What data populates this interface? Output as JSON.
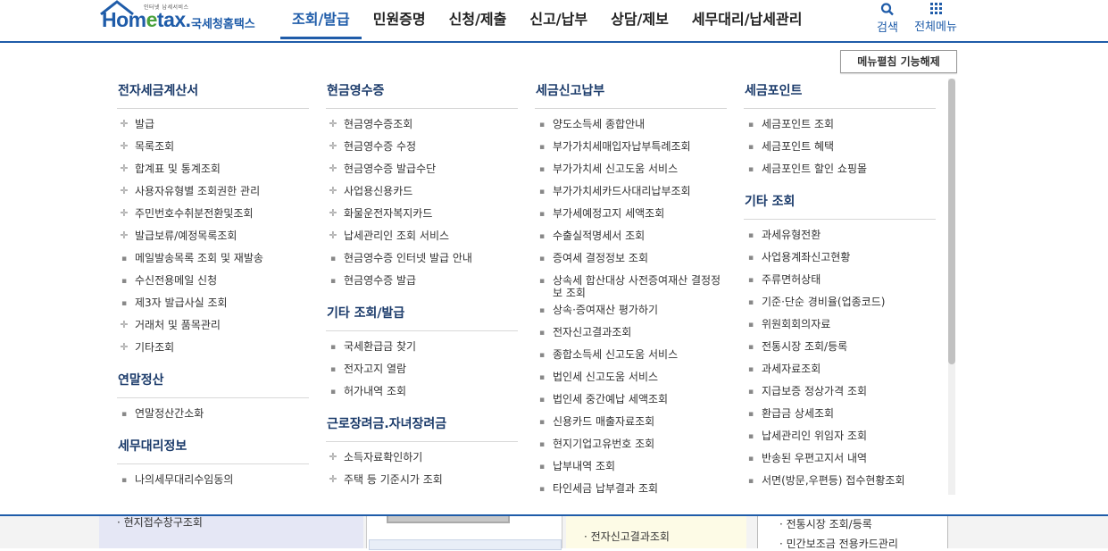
{
  "header": {
    "logo_small": "인터넷 납세서비스",
    "logo_brand_pre": "Hom",
    "logo_brand_e": "e",
    "logo_brand_post": "tax.",
    "logo_korean": "국세청홈택스",
    "nav": [
      {
        "label": "조회/발급",
        "active": true
      },
      {
        "label": "민원증명"
      },
      {
        "label": "신청/제출"
      },
      {
        "label": "신고/납부"
      },
      {
        "label": "상담/제보"
      },
      {
        "label": "세무대리/납세관리"
      }
    ],
    "search_label": "검색",
    "allmenu_label": "전체메뉴"
  },
  "panel": {
    "lock_button": "메뉴펼침 기능해제",
    "columns": [
      {
        "sections": [
          {
            "title": "전자세금계산서",
            "items": [
              {
                "label": "발급",
                "marker": "plus"
              },
              {
                "label": "목록조회",
                "marker": "plus"
              },
              {
                "label": "합계표 및 통계조회",
                "marker": "plus"
              },
              {
                "label": "사용자유형별 조회권한 관리",
                "marker": "plus"
              },
              {
                "label": "주민번호수취분전환및조회",
                "marker": "plus"
              },
              {
                "label": "발급보류/예정목록조회",
                "marker": "plus"
              },
              {
                "label": "메일발송목록 조회 및 재발송",
                "marker": "dot"
              },
              {
                "label": "수신전용메일 신청",
                "marker": "dot"
              },
              {
                "label": "제3자 발급사실 조회",
                "marker": "dot"
              },
              {
                "label": "거래처 및 품목관리",
                "marker": "plus"
              },
              {
                "label": "기타조회",
                "marker": "plus"
              }
            ]
          },
          {
            "title": "연말정산",
            "items": [
              {
                "label": "연말정산간소화",
                "marker": "dot"
              }
            ]
          },
          {
            "title": "세무대리정보",
            "items": [
              {
                "label": "나의세무대리수임동의",
                "marker": "dot"
              }
            ]
          }
        ]
      },
      {
        "sections": [
          {
            "title": "현금영수증",
            "items": [
              {
                "label": "현금영수증조회",
                "marker": "plus"
              },
              {
                "label": "현금영수증 수정",
                "marker": "plus"
              },
              {
                "label": "현금영수증 발급수단",
                "marker": "plus"
              },
              {
                "label": "사업용신용카드",
                "marker": "plus"
              },
              {
                "label": "화물운전자복지카드",
                "marker": "plus"
              },
              {
                "label": "납세관리인 조회 서비스",
                "marker": "plus"
              },
              {
                "label": "현금영수증 인터넷 발급 안내",
                "marker": "dot"
              },
              {
                "label": "현금영수증 발급",
                "marker": "dot"
              }
            ]
          },
          {
            "title": "기타 조회/발급",
            "items": [
              {
                "label": "국세환급금 찾기",
                "marker": "dot"
              },
              {
                "label": "전자고지 열람",
                "marker": "dot"
              },
              {
                "label": "허가내역 조회",
                "marker": "dot"
              }
            ]
          },
          {
            "title": "근로장려금.자녀장려금",
            "items": [
              {
                "label": "소득자료확인하기",
                "marker": "plus"
              },
              {
                "label": "주택 등 기준시가 조회",
                "marker": "plus"
              }
            ]
          }
        ]
      },
      {
        "sections": [
          {
            "title": "세금신고납부",
            "items": [
              {
                "label": "양도소득세 종합안내",
                "marker": "dot"
              },
              {
                "label": "부가가치세매입자납부특례조회",
                "marker": "dot"
              },
              {
                "label": "부가가치세 신고도움 서비스",
                "marker": "dot"
              },
              {
                "label": "부가가치세카드사대리납부조회",
                "marker": "dot"
              },
              {
                "label": "부가세예정고지 세액조회",
                "marker": "dot"
              },
              {
                "label": "수출실적명세서 조회",
                "marker": "dot"
              },
              {
                "label": "증여세 결정정보 조회",
                "marker": "dot"
              },
              {
                "label": "상속세 합산대상 사전증여재산 결정정보 조회",
                "marker": "dot"
              },
              {
                "label": "상속·증여재산 평가하기",
                "marker": "dot"
              },
              {
                "label": "전자신고결과조회",
                "marker": "dot"
              },
              {
                "label": "종합소득세 신고도움 서비스",
                "marker": "dot"
              },
              {
                "label": "법인세 신고도움 서비스",
                "marker": "dot"
              },
              {
                "label": "법인세 중간예납 세액조회",
                "marker": "dot"
              },
              {
                "label": "신용카드 매출자료조회",
                "marker": "dot"
              },
              {
                "label": "현지기업고유번호 조회",
                "marker": "dot"
              },
              {
                "label": "납부내역 조회",
                "marker": "dot"
              },
              {
                "label": "타인세금 납부결과 조회",
                "marker": "dot"
              }
            ]
          }
        ]
      },
      {
        "sections": [
          {
            "title": "세금포인트",
            "items": [
              {
                "label": "세금포인트 조회",
                "marker": "dot"
              },
              {
                "label": "세금포인트 혜택",
                "marker": "dot"
              },
              {
                "label": "세금포인트 할인 쇼핑몰",
                "marker": "dot"
              }
            ]
          },
          {
            "title": "기타 조회",
            "items": [
              {
                "label": "과세유형전환",
                "marker": "dot"
              },
              {
                "label": "사업용계좌신고현황",
                "marker": "dot"
              },
              {
                "label": "주류면허상태",
                "marker": "dot"
              },
              {
                "label": "기준·단순 경비율(업종코드)",
                "marker": "dot"
              },
              {
                "label": "위원회회의자료",
                "marker": "dot"
              },
              {
                "label": "전통시장 조회/등록",
                "marker": "dot"
              },
              {
                "label": "과세자료조회",
                "marker": "dot"
              },
              {
                "label": "지급보증 정상가격 조회",
                "marker": "dot"
              },
              {
                "label": "환급금 상세조회",
                "marker": "dot"
              },
              {
                "label": "납세관리인 위임자 조회",
                "marker": "dot"
              },
              {
                "label": "반송된 우편고지서 내역",
                "marker": "dot"
              },
              {
                "label": "서면(방문,우편등) 접수현황조회",
                "marker": "dot"
              }
            ]
          }
        ]
      }
    ]
  },
  "background": {
    "left_text": "· 현지접수창구조회",
    "center_text": "· 전자신고결과조회",
    "right_text1": "· 전통시장 조회/등록",
    "right_text2": "· 민간보조금 전용카드관리"
  }
}
